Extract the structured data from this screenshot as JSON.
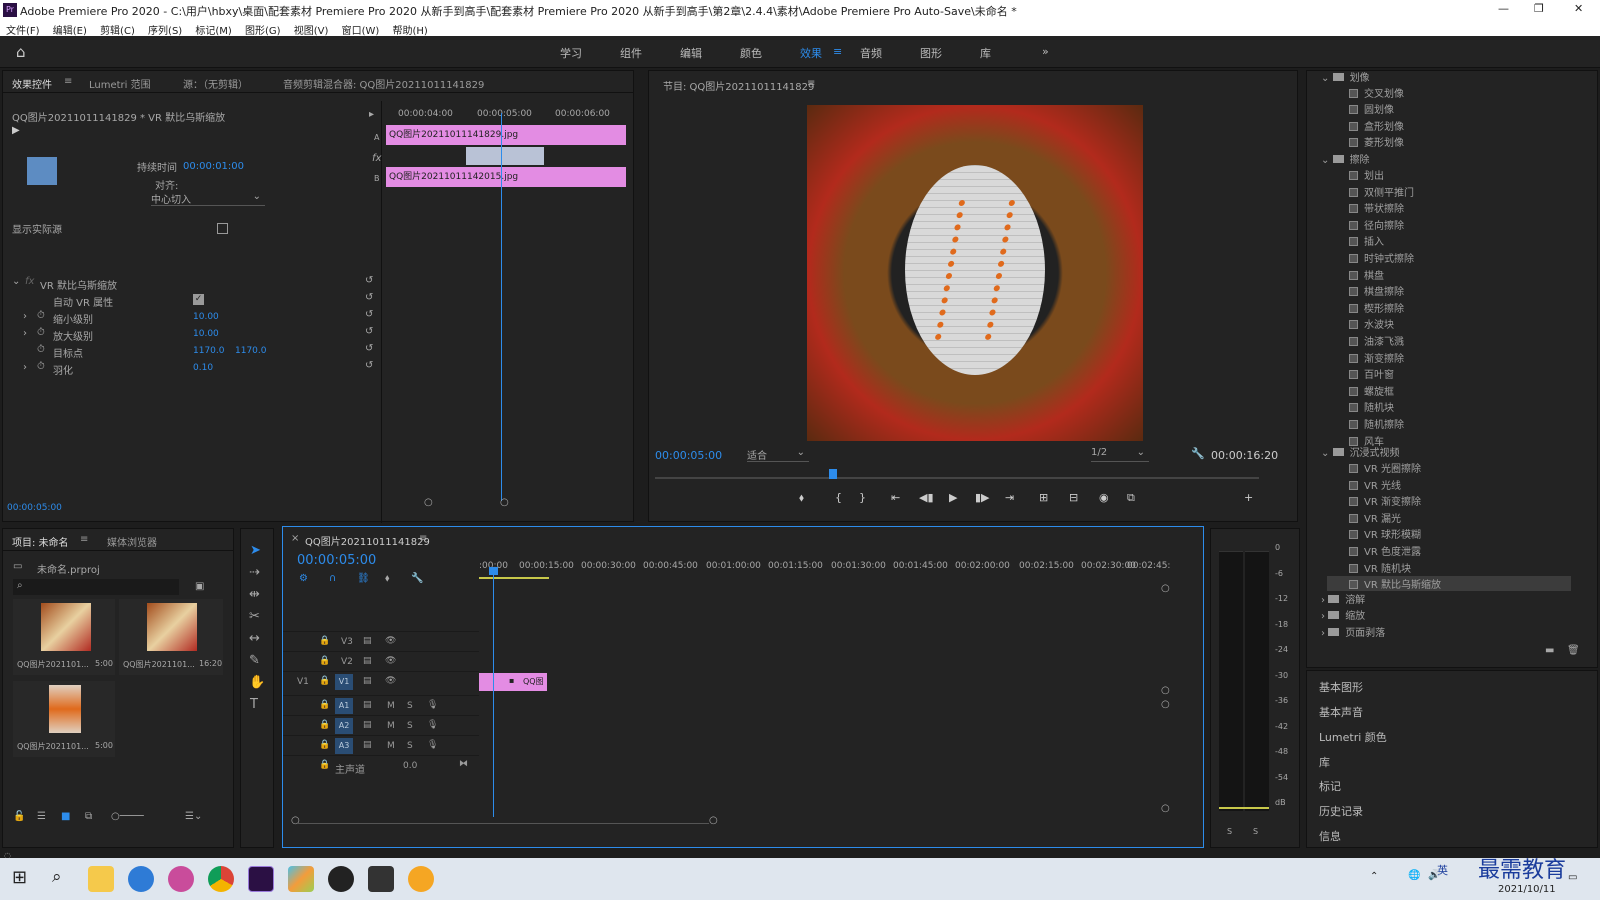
{
  "window": {
    "title": "Adobe Premiere Pro 2020 - C:\\用户\\hbxy\\桌面\\配套素材 Premiere Pro 2020 从新手到高手\\配套素材 Premiere Pro 2020 从新手到高手\\第2章\\2.4.4\\素材\\Adobe Premiere Pro Auto-Save\\未命名 *",
    "app_icon": "Pr",
    "controls": [
      "—",
      "❐",
      "✕"
    ]
  },
  "menu": [
    "文件(F)",
    "编辑(E)",
    "剪辑(C)",
    "序列(S)",
    "标记(M)",
    "图形(G)",
    "视图(V)",
    "窗口(W)",
    "帮助(H)"
  ],
  "workspaces": {
    "tabs": [
      "学习",
      "组件",
      "编辑",
      "颜色",
      "效果",
      "音频",
      "图形",
      "库"
    ],
    "active": "效果",
    "more": "»"
  },
  "effect_controls": {
    "tabs": [
      "效果控件",
      "Lumetri 范围",
      "源：（无剪辑）",
      "音频剪辑混合器: QQ图片20211011141829"
    ],
    "clip_path": "QQ图片20211011141829 * VR 默比乌斯缩放",
    "ruler": [
      "00:00:04:00",
      "00:00:05:00",
      "00:00:06:00"
    ],
    "clip_a": "QQ图片20211011141829.jpg",
    "clip_b": "QQ图片20211011142015.jpg",
    "track_letters": [
      "A",
      "B"
    ],
    "duration_label": "持续时间",
    "duration_value": "00:00:01:00",
    "align_label": "对齐:",
    "align_value": "中心切入",
    "show_source_label": "显示实际源",
    "effect_name": "VR 默比乌斯缩放",
    "props": [
      {
        "name": "自动 VR 属性",
        "value": ""
      },
      {
        "name": "缩小级别",
        "value": "10.00"
      },
      {
        "name": "放大级别",
        "value": "10.00"
      },
      {
        "name": "目标点",
        "value": "1170.0",
        "value2": "1170.0"
      },
      {
        "name": "羽化",
        "value": "0.10"
      }
    ],
    "timecode": "00:00:05:00"
  },
  "program": {
    "title": "节目: QQ图片20211011141829",
    "timecode": "00:00:05:00",
    "fit": "适合",
    "quality": "1/2",
    "duration": "00:00:16:20",
    "buttons": [
      "⬧",
      "{",
      "}",
      "⇤",
      "◀▮",
      "▶",
      "▮▶",
      "⇥",
      "⊞",
      "⊟",
      "◉",
      "⧉",
      "+"
    ]
  },
  "project": {
    "tabs": [
      "项目: 未命名",
      "媒体浏览器"
    ],
    "file": "未命名.prproj",
    "items": [
      {
        "name": "QQ图片2021101...",
        "dur": "5:00"
      },
      {
        "name": "QQ图片2021101...",
        "dur": "16:20"
      },
      {
        "name": "QQ图片2021101...",
        "dur": "5:00"
      }
    ]
  },
  "timeline": {
    "tab": "QQ图片20211011141829",
    "timecode": "00:00:05:00",
    "ruler": [
      ":00:00",
      "00:00:15:00",
      "00:00:30:00",
      "00:00:45:00",
      "00:01:00:00",
      "00:01:15:00",
      "00:01:30:00",
      "00:01:45:00",
      "00:02:00:00",
      "00:02:15:00",
      "00:02:30:00",
      "00:02:45:"
    ],
    "tracks": [
      "V3",
      "V2",
      "V1",
      "A1",
      "A2",
      "A3"
    ],
    "src_v": "V1",
    "master": "主声道",
    "master_value": "0.0",
    "clip_label": "QQ图",
    "track_btn_m": "M",
    "track_btn_s": "S"
  },
  "meter": {
    "scale": [
      "0",
      "-6",
      "-12",
      "-18",
      "-24",
      "-30",
      "-36",
      "-42",
      "-48",
      "-54",
      "dB"
    ],
    "solo": [
      "S",
      "S"
    ]
  },
  "effects_tree": {
    "top_folder": "划像",
    "items_a": [
      "交叉划像",
      "圆划像",
      "盒形划像",
      "菱形划像"
    ],
    "folder_b": "擦除",
    "items_b": [
      "划出",
      "双侧平推门",
      "带状擦除",
      "径向擦除",
      "插入",
      "时钟式擦除",
      "棋盘",
      "棋盘擦除",
      "楔形擦除",
      "水波块",
      "油漆飞溅",
      "渐变擦除",
      "百叶窗",
      "螺旋框",
      "随机块",
      "随机擦除",
      "风车"
    ],
    "folder_c": "沉浸式视频",
    "items_c": [
      "VR 光圈擦除",
      "VR 光线",
      "VR 渐变擦除",
      "VR 漏光",
      "VR 球形模糊",
      "VR 色度泄露",
      "VR 随机块",
      "VR 默比乌斯缩放"
    ],
    "folders_d": [
      "溶解",
      "缩放",
      "页面剥落"
    ],
    "selected": "VR 默比乌斯缩放"
  },
  "side_panels": [
    "基本图形",
    "基本声音",
    "Lumetri 颜色",
    "库",
    "标记",
    "历史记录",
    "信息"
  ],
  "taskbar": {
    "time": "2021/10/11",
    "ime": "英",
    "watermark": "最需教育"
  },
  "colors": {
    "accent": "#2d8ceb",
    "clip": "#e38ce3",
    "bg": "#232323"
  }
}
